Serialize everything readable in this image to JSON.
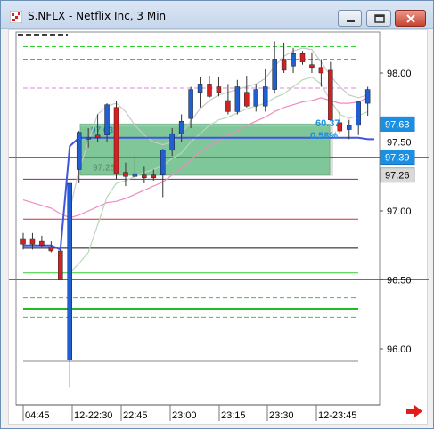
{
  "window": {
    "title": "S.NFLX - Netflix Inc, 3 Min"
  },
  "colors": {
    "up_candle": "#1f5fd1",
    "down_candle": "#d42020",
    "price_label_blue": "#1e8fe0",
    "zone_fill": "#3fb56b"
  },
  "chart_data": {
    "type": "candlestick",
    "ylim": [
      95.75,
      98.3
    ],
    "y_ticks": [
      {
        "label": "98.00",
        "value": 98.0
      },
      {
        "label": "97.50",
        "value": 97.5
      },
      {
        "label": "97.00",
        "value": 97.0
      },
      {
        "label": "96.50",
        "value": 96.5
      },
      {
        "label": "96.00",
        "value": 96.0
      }
    ],
    "x_ticks": [
      "04:45",
      "12-22:30",
      "22:45",
      "23:00",
      "23:15",
      "23:30",
      "12-23:45"
    ],
    "price_labels": [
      {
        "label": "97.63",
        "value": 97.63,
        "style": "blue"
      },
      {
        "label": "97.39",
        "value": 97.39,
        "style": "blue"
      },
      {
        "label": "97.26",
        "value": 97.26,
        "style": "gray"
      }
    ],
    "zone": {
      "top": 97.63,
      "bottom": 97.26,
      "label_top": "97.63",
      "label_bottom": "97.26"
    },
    "annotations": [
      {
        "text": "60.37",
        "value": 97.64
      },
      {
        "text": "0.58%",
        "value": 97.55
      }
    ],
    "levels": [
      {
        "value": 98.19,
        "color": "#33cc33",
        "dash": true
      },
      {
        "value": 98.1,
        "color": "#33cc33",
        "dash": true
      },
      {
        "value": 97.89,
        "color": "#dd88dd",
        "dash": true
      },
      {
        "value": 97.39,
        "color": "#2288bb",
        "dash": false
      },
      {
        "value": 97.23,
        "color": "#7a2a80",
        "dash": false
      },
      {
        "value": 96.94,
        "color": "#cc3333",
        "dash": false
      },
      {
        "value": 96.73,
        "color": "#111111",
        "dash": false
      },
      {
        "value": 96.55,
        "color": "#33cc33",
        "dash": false
      },
      {
        "value": 96.5,
        "color": "#2288bb",
        "dash": false
      },
      {
        "value": 96.37,
        "color": "#33cc33",
        "dash": true
      },
      {
        "value": 96.29,
        "color": "#22bb22",
        "dash": false
      },
      {
        "value": 96.23,
        "color": "#33cc33",
        "dash": true
      },
      {
        "value": 95.91,
        "color": "#888888",
        "dash": false
      }
    ],
    "candles": [
      {
        "o": 96.8,
        "h": 96.84,
        "l": 96.72,
        "c": 96.76
      },
      {
        "o": 96.8,
        "h": 96.84,
        "l": 96.72,
        "c": 96.76
      },
      {
        "o": 96.78,
        "h": 96.82,
        "l": 96.74,
        "c": 96.75
      },
      {
        "o": 96.74,
        "h": 96.78,
        "l": 96.7,
        "c": 96.71
      },
      {
        "o": 96.71,
        "h": 96.72,
        "l": 96.5,
        "c": 96.5
      },
      {
        "o": 95.92,
        "h": 97.2,
        "l": 95.72,
        "c": 97.2
      },
      {
        "o": 97.3,
        "h": 97.58,
        "l": 97.2,
        "c": 97.57
      },
      {
        "o": 97.52,
        "h": 97.6,
        "l": 97.46,
        "c": 97.53
      },
      {
        "o": 97.55,
        "h": 97.7,
        "l": 97.5,
        "c": 97.53
      },
      {
        "o": 97.55,
        "h": 97.78,
        "l": 97.5,
        "c": 97.77
      },
      {
        "o": 97.75,
        "h": 97.8,
        "l": 97.23,
        "c": 97.27
      },
      {
        "o": 97.28,
        "h": 97.35,
        "l": 97.18,
        "c": 97.25
      },
      {
        "o": 97.25,
        "h": 97.4,
        "l": 97.22,
        "c": 97.27
      },
      {
        "o": 97.26,
        "h": 97.32,
        "l": 97.2,
        "c": 97.24
      },
      {
        "o": 97.26,
        "h": 97.3,
        "l": 97.22,
        "c": 97.24
      },
      {
        "o": 97.26,
        "h": 97.45,
        "l": 97.1,
        "c": 97.44
      },
      {
        "o": 97.44,
        "h": 97.6,
        "l": 97.4,
        "c": 97.56
      },
      {
        "o": 97.56,
        "h": 97.7,
        "l": 97.5,
        "c": 97.65
      },
      {
        "o": 97.67,
        "h": 97.9,
        "l": 97.6,
        "c": 97.88
      },
      {
        "o": 97.86,
        "h": 97.97,
        "l": 97.75,
        "c": 97.92
      },
      {
        "o": 97.92,
        "h": 97.98,
        "l": 97.82,
        "c": 97.83
      },
      {
        "o": 97.9,
        "h": 97.97,
        "l": 97.83,
        "c": 97.86
      },
      {
        "o": 97.8,
        "h": 97.92,
        "l": 97.7,
        "c": 97.72
      },
      {
        "o": 97.72,
        "h": 97.95,
        "l": 97.7,
        "c": 97.9
      },
      {
        "o": 97.86,
        "h": 97.98,
        "l": 97.75,
        "c": 97.76
      },
      {
        "o": 97.76,
        "h": 97.92,
        "l": 97.72,
        "c": 97.88
      },
      {
        "o": 97.76,
        "h": 98.03,
        "l": 97.72,
        "c": 97.9
      },
      {
        "o": 97.88,
        "h": 98.23,
        "l": 97.85,
        "c": 98.1
      },
      {
        "o": 98.1,
        "h": 98.22,
        "l": 98.0,
        "c": 98.02
      },
      {
        "o": 98.05,
        "h": 98.18,
        "l": 98.0,
        "c": 98.14
      },
      {
        "o": 98.14,
        "h": 98.16,
        "l": 98.06,
        "c": 98.08
      },
      {
        "o": 98.06,
        "h": 98.15,
        "l": 98.0,
        "c": 98.04
      },
      {
        "o": 98.04,
        "h": 98.1,
        "l": 97.9,
        "c": 98.0
      },
      {
        "o": 98.02,
        "h": 98.08,
        "l": 97.65,
        "c": 97.66
      },
      {
        "o": 97.64,
        "h": 97.72,
        "l": 97.56,
        "c": 97.58
      },
      {
        "o": 97.59,
        "h": 97.66,
        "l": 97.52,
        "c": 97.62
      },
      {
        "o": 97.62,
        "h": 97.8,
        "l": 97.55,
        "c": 97.79
      },
      {
        "o": 97.78,
        "h": 97.9,
        "l": 97.69,
        "c": 97.88
      }
    ],
    "ma_lines": [
      {
        "name": "",
        "color": "#4455dd",
        "values": [
          96.75,
          96.75,
          96.75,
          96.75,
          96.72,
          97.47,
          97.53,
          97.53,
          97.53,
          97.53,
          97.53,
          97.53,
          97.53,
          97.53,
          97.53,
          97.53,
          97.53,
          97.53,
          97.53,
          97.53,
          97.53,
          97.53,
          97.53,
          97.53,
          97.53,
          97.53,
          97.53,
          97.53,
          97.53,
          97.53,
          97.53,
          97.53,
          97.53,
          97.53,
          97.53,
          97.53,
          97.53,
          97.52
        ]
      }
    ],
    "bands": [
      {
        "color": "#f08ac0",
        "values": [
          97.08,
          97.06,
          97.04,
          97.02,
          96.98,
          96.95,
          96.97,
          97.0,
          97.03,
          97.06,
          97.07,
          97.09,
          97.12,
          97.15,
          97.18,
          97.21,
          97.26,
          97.31,
          97.37,
          97.43,
          97.47,
          97.51,
          97.55,
          97.58,
          97.62,
          97.65,
          97.68,
          97.72,
          97.75,
          97.77,
          97.79,
          97.8,
          97.82,
          97.8,
          97.78,
          97.78,
          97.79,
          97.82
        ]
      },
      {
        "color": "#b8d8b8",
        "values": [
          null,
          null,
          null,
          null,
          null,
          96.55,
          96.62,
          96.7,
          96.9,
          97.1,
          97.2,
          97.22,
          97.25,
          97.28,
          97.3,
          97.33,
          97.38,
          97.42,
          97.5,
          97.56,
          97.62,
          97.66,
          97.68,
          97.71,
          97.74,
          97.76,
          97.78,
          97.82,
          97.85,
          97.9,
          97.95,
          97.97,
          97.92,
          97.8,
          97.7,
          97.67,
          97.69,
          97.72
        ]
      },
      {
        "color": "#c8c8c8",
        "values": [
          null,
          null,
          null,
          null,
          null,
          97.0,
          97.3,
          97.5,
          97.7,
          97.76,
          97.78,
          97.72,
          97.62,
          97.55,
          97.5,
          97.48,
          97.5,
          97.56,
          97.65,
          97.74,
          97.8,
          97.84,
          97.86,
          97.88,
          97.9,
          97.92,
          97.96,
          98.05,
          98.12,
          98.16,
          98.18,
          98.17,
          98.08,
          97.98,
          97.9,
          97.84,
          97.82,
          97.84
        ]
      }
    ]
  }
}
